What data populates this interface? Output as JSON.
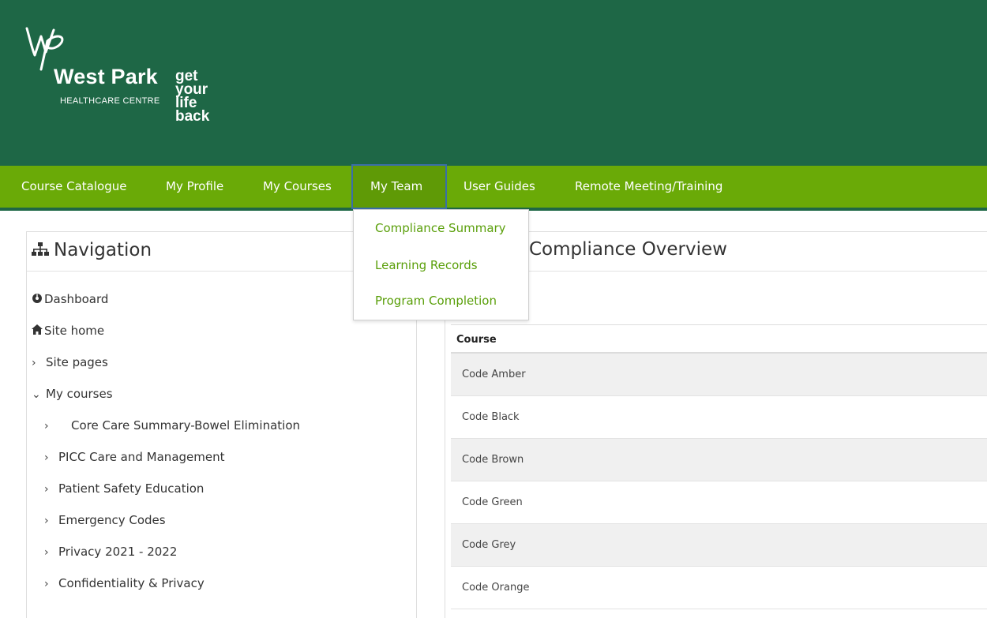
{
  "brand": {
    "name": "West Park",
    "subtitle": "HEALTHCARE CENTRE",
    "tagline": [
      "get",
      "your",
      "life",
      "back"
    ],
    "header_color": "#1e6746",
    "nav_color": "#6aaa07",
    "accent_green": "#5a9f0a"
  },
  "navbar": {
    "items": [
      {
        "label": "Course Catalogue"
      },
      {
        "label": "My Profile"
      },
      {
        "label": "My Courses"
      },
      {
        "label": "My Team",
        "active": true
      },
      {
        "label": "User Guides"
      },
      {
        "label": "Remote Meeting/Training"
      }
    ]
  },
  "dropdown": {
    "items": [
      {
        "label": "Compliance Summary"
      },
      {
        "label": "Learning Records"
      },
      {
        "label": "Program Completion"
      }
    ]
  },
  "navigation": {
    "title": "Navigation",
    "dashboard": "Dashboard",
    "site_home": "Site home",
    "site_pages": "Site pages",
    "my_courses": "My courses",
    "courses": [
      "Core Care Summary-Bowel Elimination",
      "PICC Care and Management",
      "Patient Safety Education",
      "Emergency Codes",
      "Privacy 2021 - 2022",
      "Confidentiality & Privacy"
    ]
  },
  "main": {
    "title": "Compliance Overview",
    "table": {
      "header": "Course",
      "rows": [
        "Code Amber",
        "Code Black",
        "Code Brown",
        "Code Green",
        "Code Grey",
        "Code Orange"
      ]
    }
  }
}
